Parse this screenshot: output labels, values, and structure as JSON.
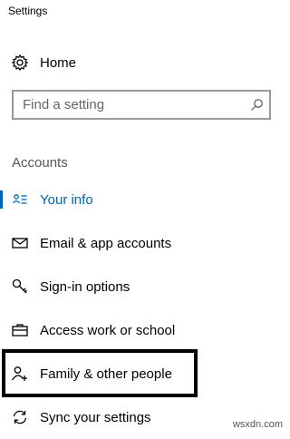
{
  "window": {
    "title": "Settings"
  },
  "home": {
    "label": "Home",
    "icon": "gear-icon"
  },
  "search": {
    "placeholder": "Find a setting",
    "value": "",
    "icon": "search-icon"
  },
  "section": {
    "header": "Accounts"
  },
  "nav": {
    "items": [
      {
        "label": "Your info",
        "icon": "person-card-icon",
        "active": true
      },
      {
        "label": "Email & app accounts",
        "icon": "envelope-icon",
        "active": false
      },
      {
        "label": "Sign-in options",
        "icon": "key-icon",
        "active": false
      },
      {
        "label": "Access work or school",
        "icon": "briefcase-icon",
        "active": false
      },
      {
        "label": "Family & other people",
        "icon": "add-person-icon",
        "active": false,
        "highlighted": true
      },
      {
        "label": "Sync your settings",
        "icon": "sync-icon",
        "active": false
      }
    ]
  },
  "colors": {
    "accent": "#0063b1",
    "highlight_border": "#000000",
    "search_border": "#999999"
  },
  "watermark": "wsxdn.com"
}
